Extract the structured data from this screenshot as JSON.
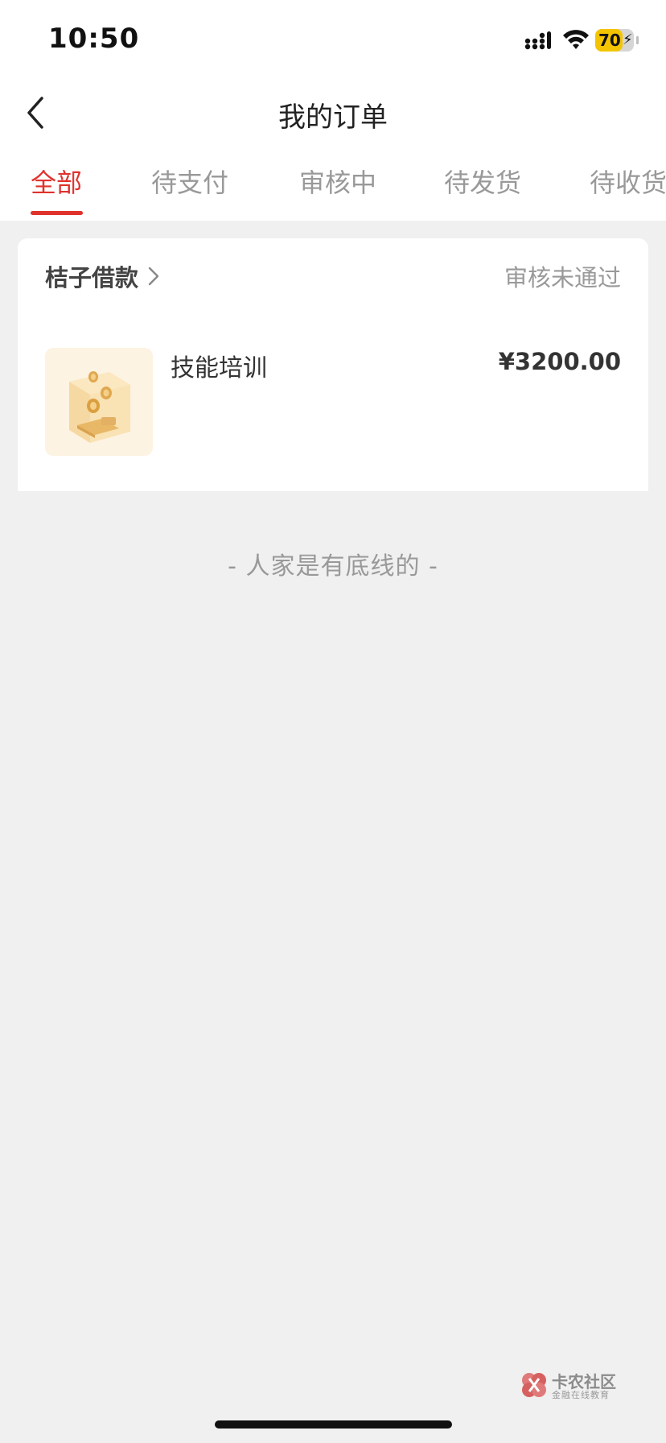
{
  "status_bar": {
    "time": "10:50",
    "battery_text": "70",
    "battery_percent": 70,
    "signal_icon": "cellular-signal-icon",
    "wifi_icon": "wifi-icon",
    "battery_icon": "battery-charging-icon"
  },
  "nav": {
    "title": "我的订单",
    "back_icon": "chevron-left-icon"
  },
  "tabs": [
    {
      "label": "全部",
      "active": true
    },
    {
      "label": "待支付",
      "active": false
    },
    {
      "label": "审核中",
      "active": false
    },
    {
      "label": "待发货",
      "active": false
    },
    {
      "label": "待收货",
      "active": false
    }
  ],
  "order": {
    "merchant": "桔子借款",
    "status": "审核未通过",
    "product_name": "技能培训",
    "price": "¥3200.00",
    "product_icon": "coin-cube-icon"
  },
  "end_text": "- 人家是有底线的 -",
  "watermark": {
    "main": "卡农社区",
    "sub": "金融在线教育"
  },
  "colors": {
    "accent": "#e0322d",
    "background": "#f0f0f0",
    "muted_text": "#999999",
    "battery": "#f5c400"
  }
}
